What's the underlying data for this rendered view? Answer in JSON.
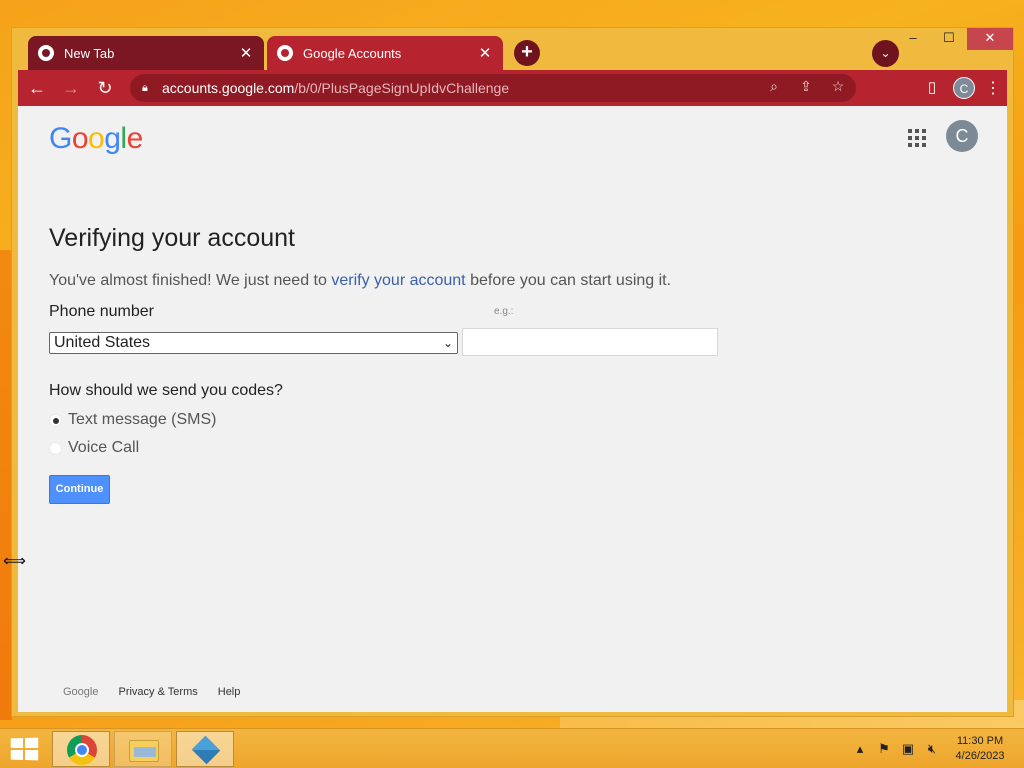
{
  "browser": {
    "tabs": [
      {
        "title": "New Tab",
        "close": "✕"
      },
      {
        "title": "Google Accounts",
        "close": "✕"
      }
    ],
    "new_tab": "+",
    "tab_search": "⌄",
    "window_controls": {
      "minimize": "–",
      "maximize": "☐",
      "close": "✕"
    },
    "toolbar": {
      "back": "←",
      "forward": "→",
      "reload": "↻",
      "url_domain": "accounts.google.com",
      "url_path": "/b/0/PlusPageSignUpIdvChallenge",
      "profile_initial": "C"
    }
  },
  "page": {
    "logo_letters": [
      "G",
      "o",
      "o",
      "g",
      "l",
      "e"
    ],
    "account_initial": "C",
    "heading": "Verifying your account",
    "intro_before": "You've almost finished! We just need to ",
    "intro_link": "verify your account",
    "intro_after": " before you can start using it.",
    "phone_label": "Phone number",
    "eg_hint": "e.g.:",
    "country_selected": "United States",
    "phone_value": "",
    "codes_label": "How should we send you codes?",
    "options": [
      {
        "label": "Text message (SMS)",
        "checked": true
      },
      {
        "label": "Voice Call",
        "checked": false
      }
    ],
    "continue_label": "Continue",
    "footer": {
      "brand": "Google",
      "privacy": "Privacy & Terms",
      "help": "Help"
    }
  },
  "taskbar": {
    "time": "11:30 PM",
    "date": "4/26/2023"
  },
  "colors": {
    "tab_active": "#b6242f",
    "tab_inactive": "#7a1722",
    "link": "#3b5fa8",
    "button": "#4d90fe"
  }
}
